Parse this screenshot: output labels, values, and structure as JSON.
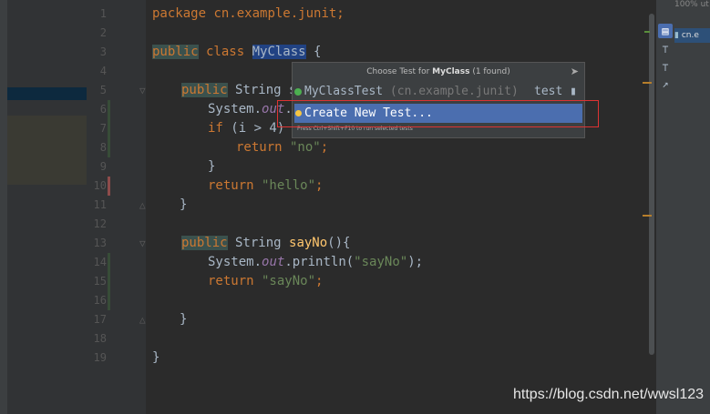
{
  "gutter": {
    "line_numbers": [
      "1",
      "2",
      "3",
      "4",
      "5",
      "6",
      "7",
      "8",
      "9",
      "10",
      "11",
      "12",
      "13",
      "14",
      "15",
      "16",
      "17",
      "18",
      "19"
    ]
  },
  "code": {
    "line1": {
      "kw": "package",
      "rest": " cn.example.junit;"
    },
    "line3": {
      "kw": "public",
      "kw2": " class ",
      "cls": "MyClass",
      "rest": " {"
    },
    "line5": {
      "kw": "public",
      "rest": " String sa"
    },
    "line6": {
      "pre": "System.",
      "it": "out",
      "rest": ".p"
    },
    "line7": {
      "kw": "if",
      "rest": " (i > 4) {"
    },
    "line8": {
      "kw": "return",
      "str": " \"no\"",
      "rest": ";"
    },
    "line9": {
      "text": "}"
    },
    "line10": {
      "kw": "return",
      "str": " \"hello\"",
      "rest": ";"
    },
    "line11": {
      "text": "}"
    },
    "line13": {
      "kw": "public",
      "rest": " String ",
      "fn": "sayNo",
      "rest2": "(){"
    },
    "line14": {
      "pre": "System.",
      "it": "out",
      "rest": ".println(",
      "str": "\"sayNo\"",
      "rest2": ");"
    },
    "line15": {
      "kw": "return",
      "str": " \"sayNo\"",
      "rest": ";"
    },
    "line16": {
      "text": "}"
    },
    "line18": {
      "text": "}"
    }
  },
  "popup": {
    "title_prefix": "Choose Test for ",
    "title_class": "MyClass",
    "title_suffix": " (1 found)",
    "item1_name": "MyClassTest",
    "item1_pkg": " (cn.example.junit)",
    "item1_module": "test",
    "item2_label": "Create New Test...",
    "hint": "Press Ctrl+Shift+F10 to run selected tests"
  },
  "right_panel": {
    "header": "100% ut",
    "item": "cn.e"
  },
  "watermark": "https://blog.csdn.net/wwsl123",
  "colors": {
    "background": "#2b2b2b",
    "keyword": "#cc7832",
    "string": "#6a8759",
    "selection": "#4b6eaf",
    "highlight_box": "#dd3333"
  }
}
